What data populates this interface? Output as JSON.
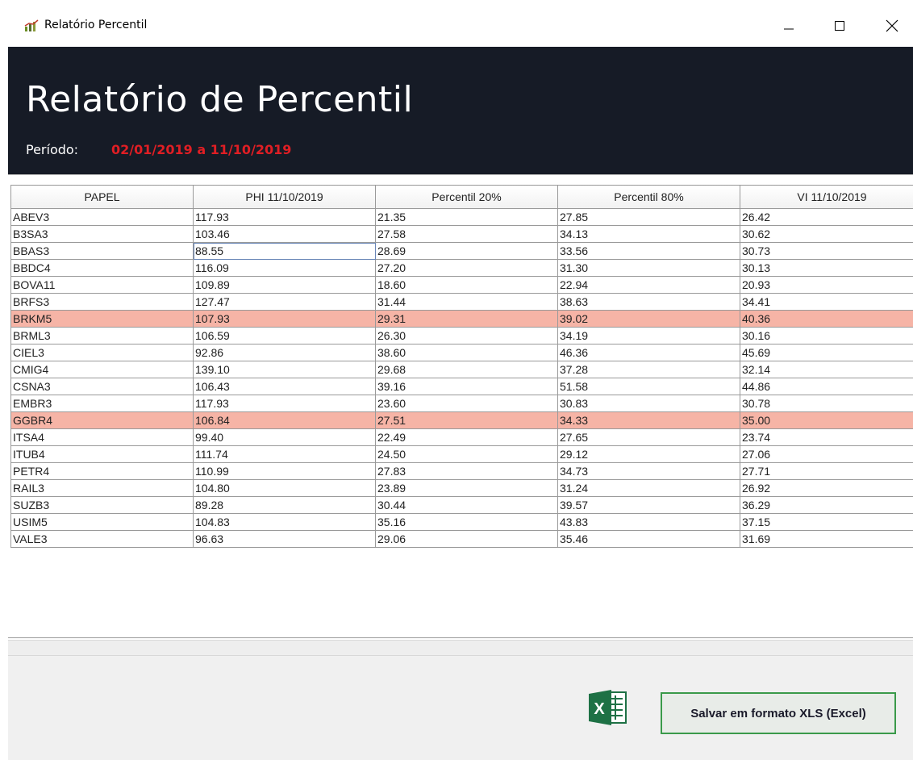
{
  "window": {
    "title": "Relatório Percentil",
    "controls": {
      "minimize": "minimize-icon",
      "maximize": "maximize-icon",
      "close": "close-icon"
    }
  },
  "header": {
    "title": "Relatório de Percentil",
    "period_label": "Período:",
    "period_value": "02/01/2019 a 11/10/2019",
    "background_color": "#161b26",
    "period_value_color": "#e01e24"
  },
  "table": {
    "columns": [
      "PAPEL",
      "PHI 11/10/2019",
      "Percentil 20%",
      "Percentil 80%",
      "VI 11/10/2019"
    ],
    "highlight_color": "#f6b4a6",
    "rows": [
      {
        "cells": [
          "ABEV3",
          "117.93",
          "21.35",
          "27.85",
          "26.42"
        ],
        "highlight": false
      },
      {
        "cells": [
          "B3SA3",
          "103.46",
          "27.58",
          "34.13",
          "30.62"
        ],
        "highlight": false
      },
      {
        "cells": [
          "BBAS3",
          "88.55",
          "28.69",
          "33.56",
          "30.73"
        ],
        "highlight": false,
        "focused_col": 1
      },
      {
        "cells": [
          "BBDC4",
          "116.09",
          "27.20",
          "31.30",
          "30.13"
        ],
        "highlight": false
      },
      {
        "cells": [
          "BOVA11",
          "109.89",
          "18.60",
          "22.94",
          "20.93"
        ],
        "highlight": false
      },
      {
        "cells": [
          "BRFS3",
          "127.47",
          "31.44",
          "38.63",
          "34.41"
        ],
        "highlight": false
      },
      {
        "cells": [
          "BRKM5",
          "107.93",
          "29.31",
          "39.02",
          "40.36"
        ],
        "highlight": true
      },
      {
        "cells": [
          "BRML3",
          "106.59",
          "26.30",
          "34.19",
          "30.16"
        ],
        "highlight": false
      },
      {
        "cells": [
          "CIEL3",
          "92.86",
          "38.60",
          "46.36",
          "45.69"
        ],
        "highlight": false
      },
      {
        "cells": [
          "CMIG4",
          "139.10",
          "29.68",
          "37.28",
          "32.14"
        ],
        "highlight": false
      },
      {
        "cells": [
          "CSNA3",
          "106.43",
          "39.16",
          "51.58",
          "44.86"
        ],
        "highlight": false
      },
      {
        "cells": [
          "EMBR3",
          "117.93",
          "23.60",
          "30.83",
          "30.78"
        ],
        "highlight": false
      },
      {
        "cells": [
          "GGBR4",
          "106.84",
          "27.51",
          "34.33",
          "35.00"
        ],
        "highlight": true
      },
      {
        "cells": [
          "ITSA4",
          "99.40",
          "22.49",
          "27.65",
          "23.74"
        ],
        "highlight": false
      },
      {
        "cells": [
          "ITUB4",
          "111.74",
          "24.50",
          "29.12",
          "27.06"
        ],
        "highlight": false
      },
      {
        "cells": [
          "PETR4",
          "110.99",
          "27.83",
          "34.73",
          "27.71"
        ],
        "highlight": false
      },
      {
        "cells": [
          "RAIL3",
          "104.80",
          "23.89",
          "31.24",
          "26.92"
        ],
        "highlight": false
      },
      {
        "cells": [
          "SUZB3",
          "89.28",
          "30.44",
          "39.57",
          "36.29"
        ],
        "highlight": false
      },
      {
        "cells": [
          "USIM5",
          "104.83",
          "35.16",
          "43.83",
          "37.15"
        ],
        "highlight": false
      },
      {
        "cells": [
          "VALE3",
          "96.63",
          "29.06",
          "35.46",
          "31.69"
        ],
        "highlight": false
      }
    ]
  },
  "footer": {
    "excel_icon": "excel-icon",
    "excel_icon_text": "X",
    "save_button_label": "Salvar em formato XLS (Excel)",
    "save_button_border_color": "#3a9a4a"
  }
}
